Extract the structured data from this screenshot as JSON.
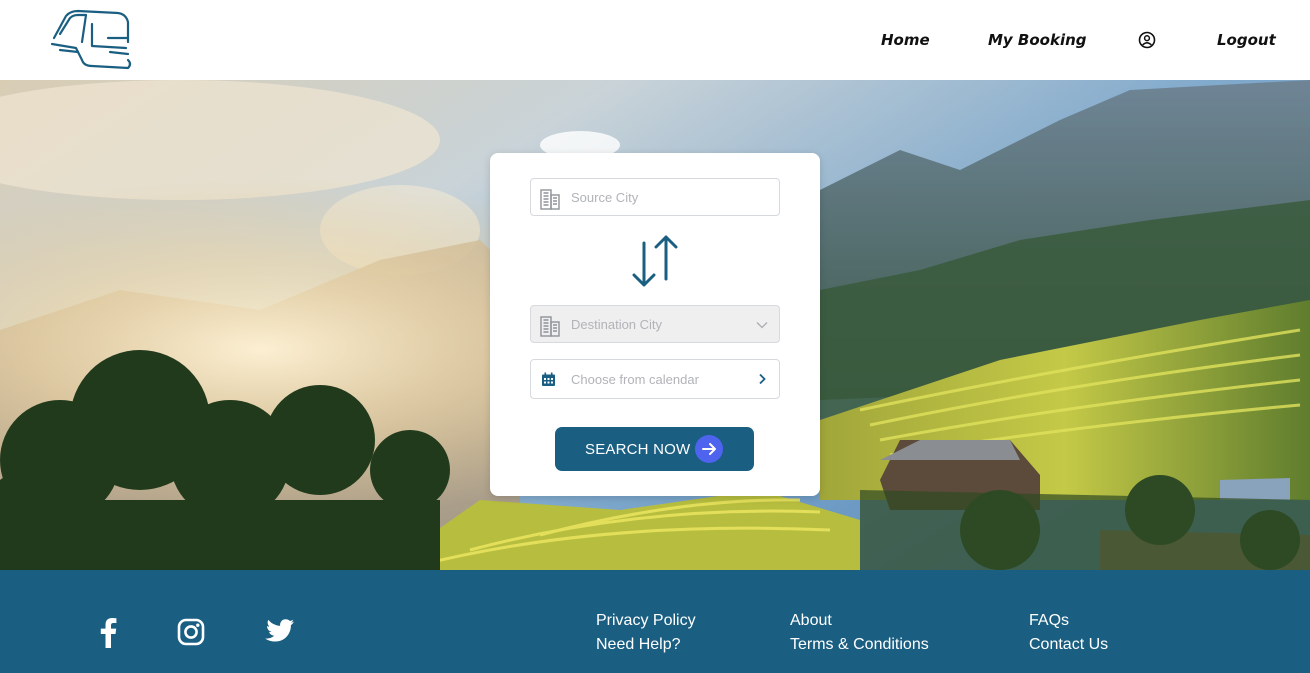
{
  "nav": {
    "home": "Home",
    "my_booking": "My Booking",
    "logout": "Logout"
  },
  "search": {
    "source_placeholder": "Source City",
    "destination_placeholder": "Destination City",
    "date_placeholder": "Choose from calendar",
    "button_label": "SEARCH NOW"
  },
  "icons": {
    "logo": "bus-logo-icon",
    "profile": "user-circle-icon",
    "source": "building-icon",
    "destination": "building-icon",
    "swap": "swap-arrows-icon",
    "calendar": "calendar-icon",
    "date_chevron": "chevron-right-icon",
    "dest_chevron": "chevron-down-icon",
    "search_arrow": "arrow-right-icon",
    "social": [
      "facebook-icon",
      "instagram-icon",
      "twitter-icon"
    ]
  },
  "footer": {
    "links": [
      [
        "Privacy Policy",
        "Need Help?"
      ],
      [
        "About",
        "Terms & Conditions"
      ],
      [
        "FAQs",
        "Contact Us"
      ]
    ]
  },
  "colors": {
    "brand": "#1a5f82",
    "accent": "#4e63ee",
    "nav_text": "#111111",
    "placeholder": "#b0b3b8"
  }
}
